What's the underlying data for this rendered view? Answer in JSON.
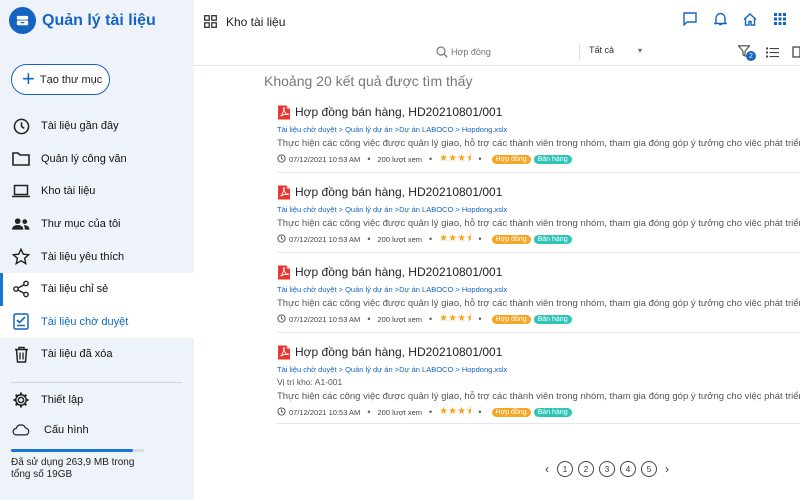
{
  "app": {
    "title": "Quản lý tài liệu"
  },
  "sidebar": {
    "create_label": "Tạo thư mục",
    "items": [
      {
        "label": "Tài liệu gần đây",
        "icon": "clock-icon"
      },
      {
        "label": "Quản lý công văn",
        "icon": "folder-icon"
      },
      {
        "label": "Kho  tài liệu",
        "icon": "laptop-icon"
      },
      {
        "label": "Thư mục  của tôi",
        "icon": "people-icon"
      },
      {
        "label": "Tài liệu yêu thích",
        "icon": "star-icon"
      },
      {
        "label": "Tài liệu chỉ sẻ",
        "icon": "share-icon"
      },
      {
        "label": "Tài liệu chờ duyệt",
        "icon": "checklist-icon"
      },
      {
        "label": "Tài liệu đã xóa",
        "icon": "trash-icon"
      }
    ],
    "settings_label": "Thiết lập",
    "config_label": "Cấu hình",
    "storage_text": "Đã sử dụng 263,9 MB trong tổng số 19GB",
    "storage_fraction": 0.92
  },
  "header": {
    "title": "Kho tài liệu"
  },
  "search": {
    "placeholder": "Hợp đồng",
    "scope": "Tất cả",
    "filter_count": "2"
  },
  "results": {
    "count_text": "Khoảng 20 kết quả được tìm thấy",
    "items": [
      {
        "title": "Hợp đồng bán hàng, HD20210801/001",
        "path": "Tài liệu chờ duyệt > Quản lý dự án >Dự án LABOCO > Hopdong.xslx",
        "location": "",
        "description": "Thực hiện các công việc được quản lý giao, hỗ trợ các thành viên trong nhóm, tham gia đóng góp ý tưởng cho việc phát triển công ty",
        "date": "07/12/2021 10:53 AM",
        "views": "200 lượt xem",
        "rating": 3.5,
        "tags": [
          "Hợp đồng",
          "Bán hàng"
        ]
      },
      {
        "title": "Hợp đồng bán hàng, HD20210801/001",
        "path": "Tài liệu chờ duyệt > Quản lý dự án >Dự án LABOCO > Hopdong.xslx",
        "location": "",
        "description": "Thực hiện các công việc được quản lý giao, hỗ trợ các thành viên trong nhóm, tham gia đóng góp ý tưởng cho việc phát triển công ty",
        "date": "07/12/2021 10:53 AM",
        "views": "200 lượt xem",
        "rating": 3.5,
        "tags": [
          "Hợp đồng",
          "Bán hàng"
        ]
      },
      {
        "title": "Hợp đồng bán hàng, HD20210801/001",
        "path": "Tài liệu chờ duyệt > Quản lý dự án >Dự án LABOCO > Hopdong.xslx",
        "location": "",
        "description": "Thực hiện các công việc được quản lý giao, hỗ trợ các thành viên trong nhóm, tham gia đóng góp ý tưởng cho việc phát triển công ty",
        "date": "07/12/2021 10:53 AM",
        "views": "200 lượt xem",
        "rating": 3.5,
        "tags": [
          "Hợp đồng",
          "Bán hàng"
        ]
      },
      {
        "title": "Hợp đồng bán hàng, HD20210801/001",
        "path": "Tài liệu chờ duyệt > Quản lý dự án >Dự án LABOCO > Hopdong.xslx",
        "location": "Vị trí kho: A1-001",
        "description": "Thực hiện các công việc được quản lý giao, hỗ trợ các thành viên trong nhóm, tham gia đóng góp ý tưởng cho việc phát triển công ty",
        "date": "07/12/2021 10:53 AM",
        "views": "200 lượt xem",
        "rating": 3.5,
        "tags": [
          "Hợp đồng",
          "Bán hàng"
        ]
      }
    ]
  },
  "pagination": {
    "pages": [
      "1",
      "2",
      "3",
      "4",
      "5"
    ]
  },
  "colors": {
    "brand": "#1565c0",
    "star": "#f5a623",
    "tag_orange": "#f5a623",
    "tag_teal": "#2ec4b6"
  }
}
